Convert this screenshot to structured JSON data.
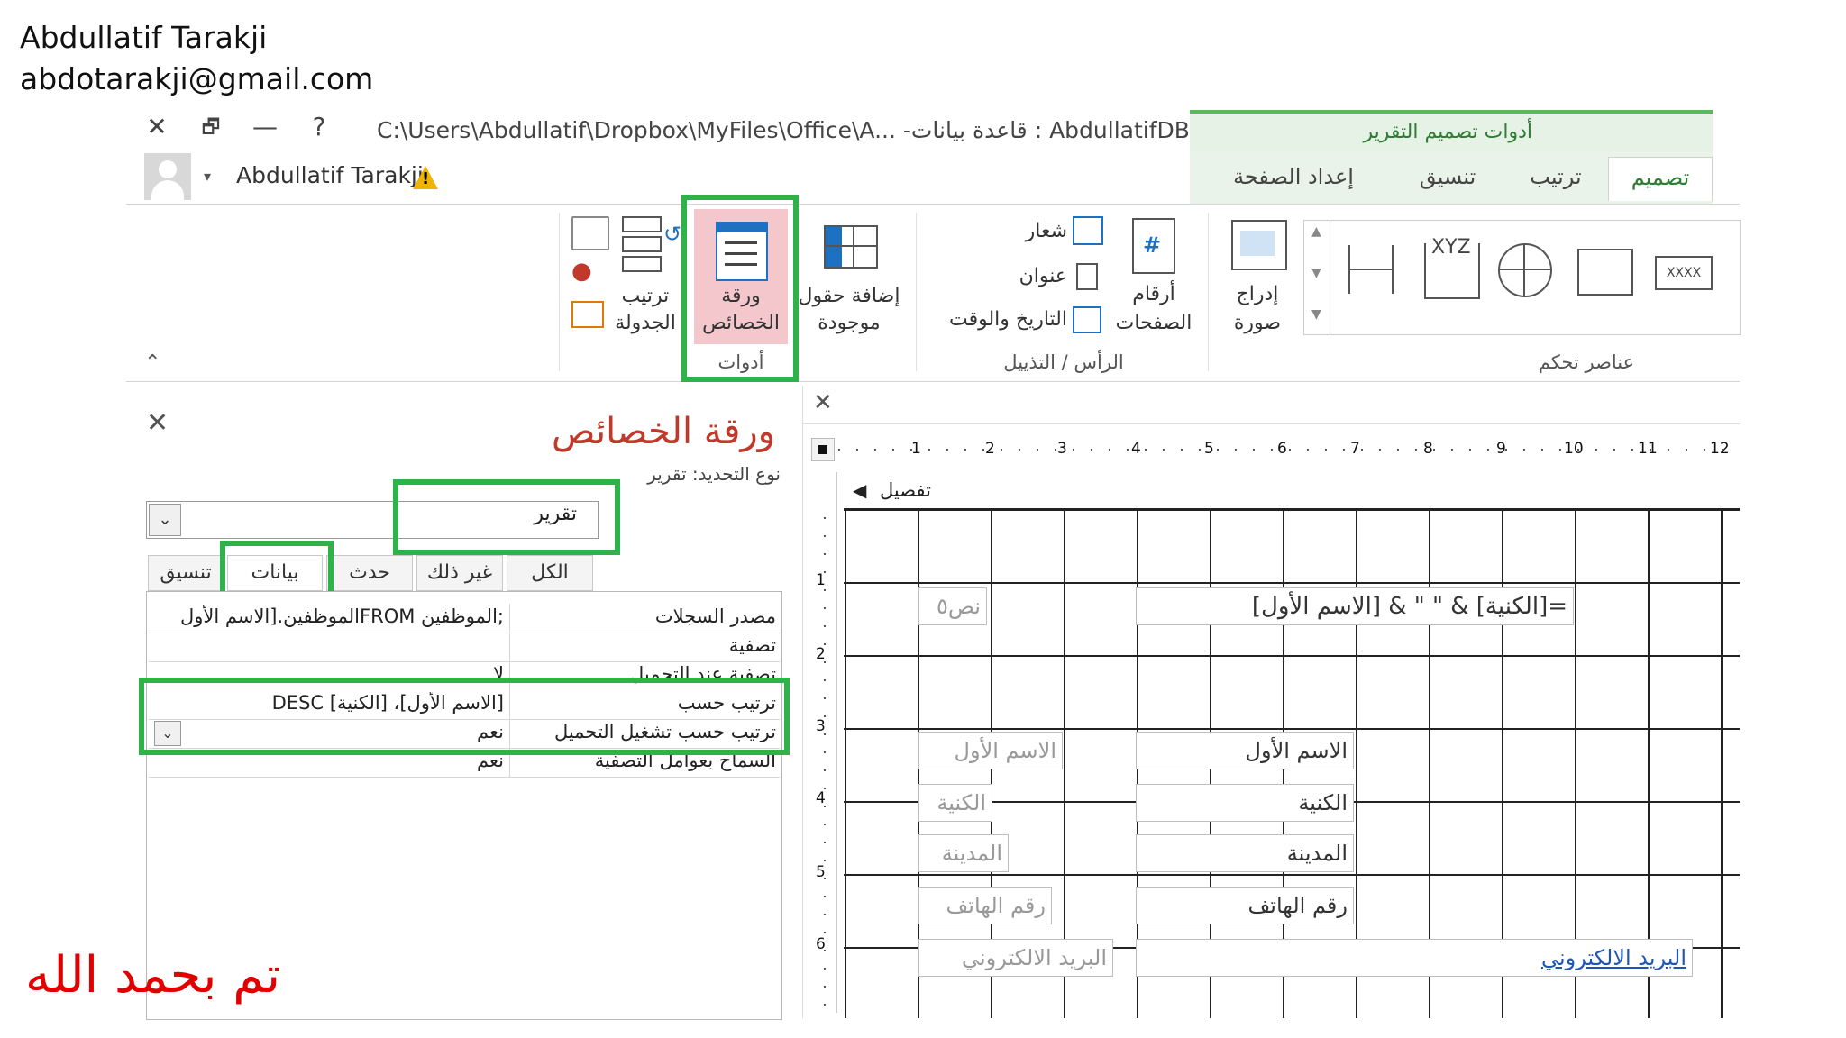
{
  "author": {
    "name": "Abdullatif Tarakji",
    "email": "abdotarakji@gmail.com"
  },
  "titlebar": {
    "path": "C:\\Users\\Abdullatif\\Dropbox\\MyFiles\\Office\\A... -قاعدة بيانات : AbdullatifDBR",
    "contextual_tools": "أدوات تصميم التقرير",
    "close": "✕",
    "restore": "🗗",
    "minimize": "—",
    "help": "?"
  },
  "account": {
    "user": "Abdullatif Tarakji",
    "warning": "!"
  },
  "ribbon_tabs": [
    "تصميم",
    "ترتيب",
    "تنسيق",
    "إعداد الصفحة"
  ],
  "ribbon": {
    "tools": {
      "property_sheet_1": "ورقة",
      "property_sheet_2": "الخصائص",
      "tab_order_1": "ترتيب",
      "tab_order_2": "الجدولة",
      "add_fields_1": "إضافة حقول",
      "add_fields_2": "موجودة",
      "group": "أدوات"
    },
    "header_footer": {
      "logo": "شعار",
      "title": "عنوان",
      "date_time": "التاريخ والوقت",
      "page_numbers_1": "أرقام",
      "page_numbers_2": "الصفحات",
      "group": "الرأس / التذييل"
    },
    "controls": {
      "insert_image_1": "إدراج",
      "insert_image_2": "صورة",
      "xyz": "XYZ",
      "xxxx": "XXXX",
      "hash": "#",
      "group": "عناصر تحكم"
    }
  },
  "property_sheet": {
    "title": "ورقة الخصائص",
    "selection_type": "نوع التحديد:  تقرير",
    "selector_value": "تقرير",
    "close": "✕",
    "tabs": [
      "تنسيق",
      "بيانات",
      "حدث",
      "غير ذلك",
      "الكل"
    ],
    "rows": [
      {
        "label": "مصدر السجلات",
        "value": ";الموظفين FROMالموظفين.[الاسم الأول"
      },
      {
        "label": "تصفية",
        "value": ""
      },
      {
        "label": "تصفية عند التحميل",
        "value": "لا"
      },
      {
        "label": "ترتيب حسب",
        "value": "[الاسم الأول]، [الكنية] DESC"
      },
      {
        "label": "ترتيب حسب تشغيل التحميل",
        "value": "نعم"
      },
      {
        "label": "السماح بعوامل التصفية",
        "value": "نعم"
      }
    ]
  },
  "design": {
    "close": "✕",
    "section": "تفصيل",
    "ruler_h": [
      "1",
      "2",
      "3",
      "4",
      "5",
      "6",
      "7",
      "8",
      "9",
      "10",
      "11",
      "12"
    ],
    "ruler_v": [
      "1",
      "2",
      "3",
      "4",
      "5",
      "6"
    ],
    "controls": {
      "text_label": "نص٥",
      "expression": "=[الكنية] & \" \" & [الاسم الأول]",
      "first_name_label": "الاسم الأول",
      "first_name": "الاسم الأول",
      "last_name_label": "الكنية",
      "last_name": "الكنية",
      "city_label": "المدينة",
      "city": "المدينة",
      "phone_label": "رقم الهاتف",
      "phone": "رقم الهاتف",
      "email_label": "البريد الالكتروني",
      "email": "البريد الالكتروني"
    }
  },
  "footer_note": "تم بحمد الله",
  "colors": {
    "highlight": "#2db34a",
    "accent": "#2e7d32",
    "title_red": "#c0392b",
    "note_red": "#e00000",
    "selected_btn": "#f4c7cc"
  }
}
